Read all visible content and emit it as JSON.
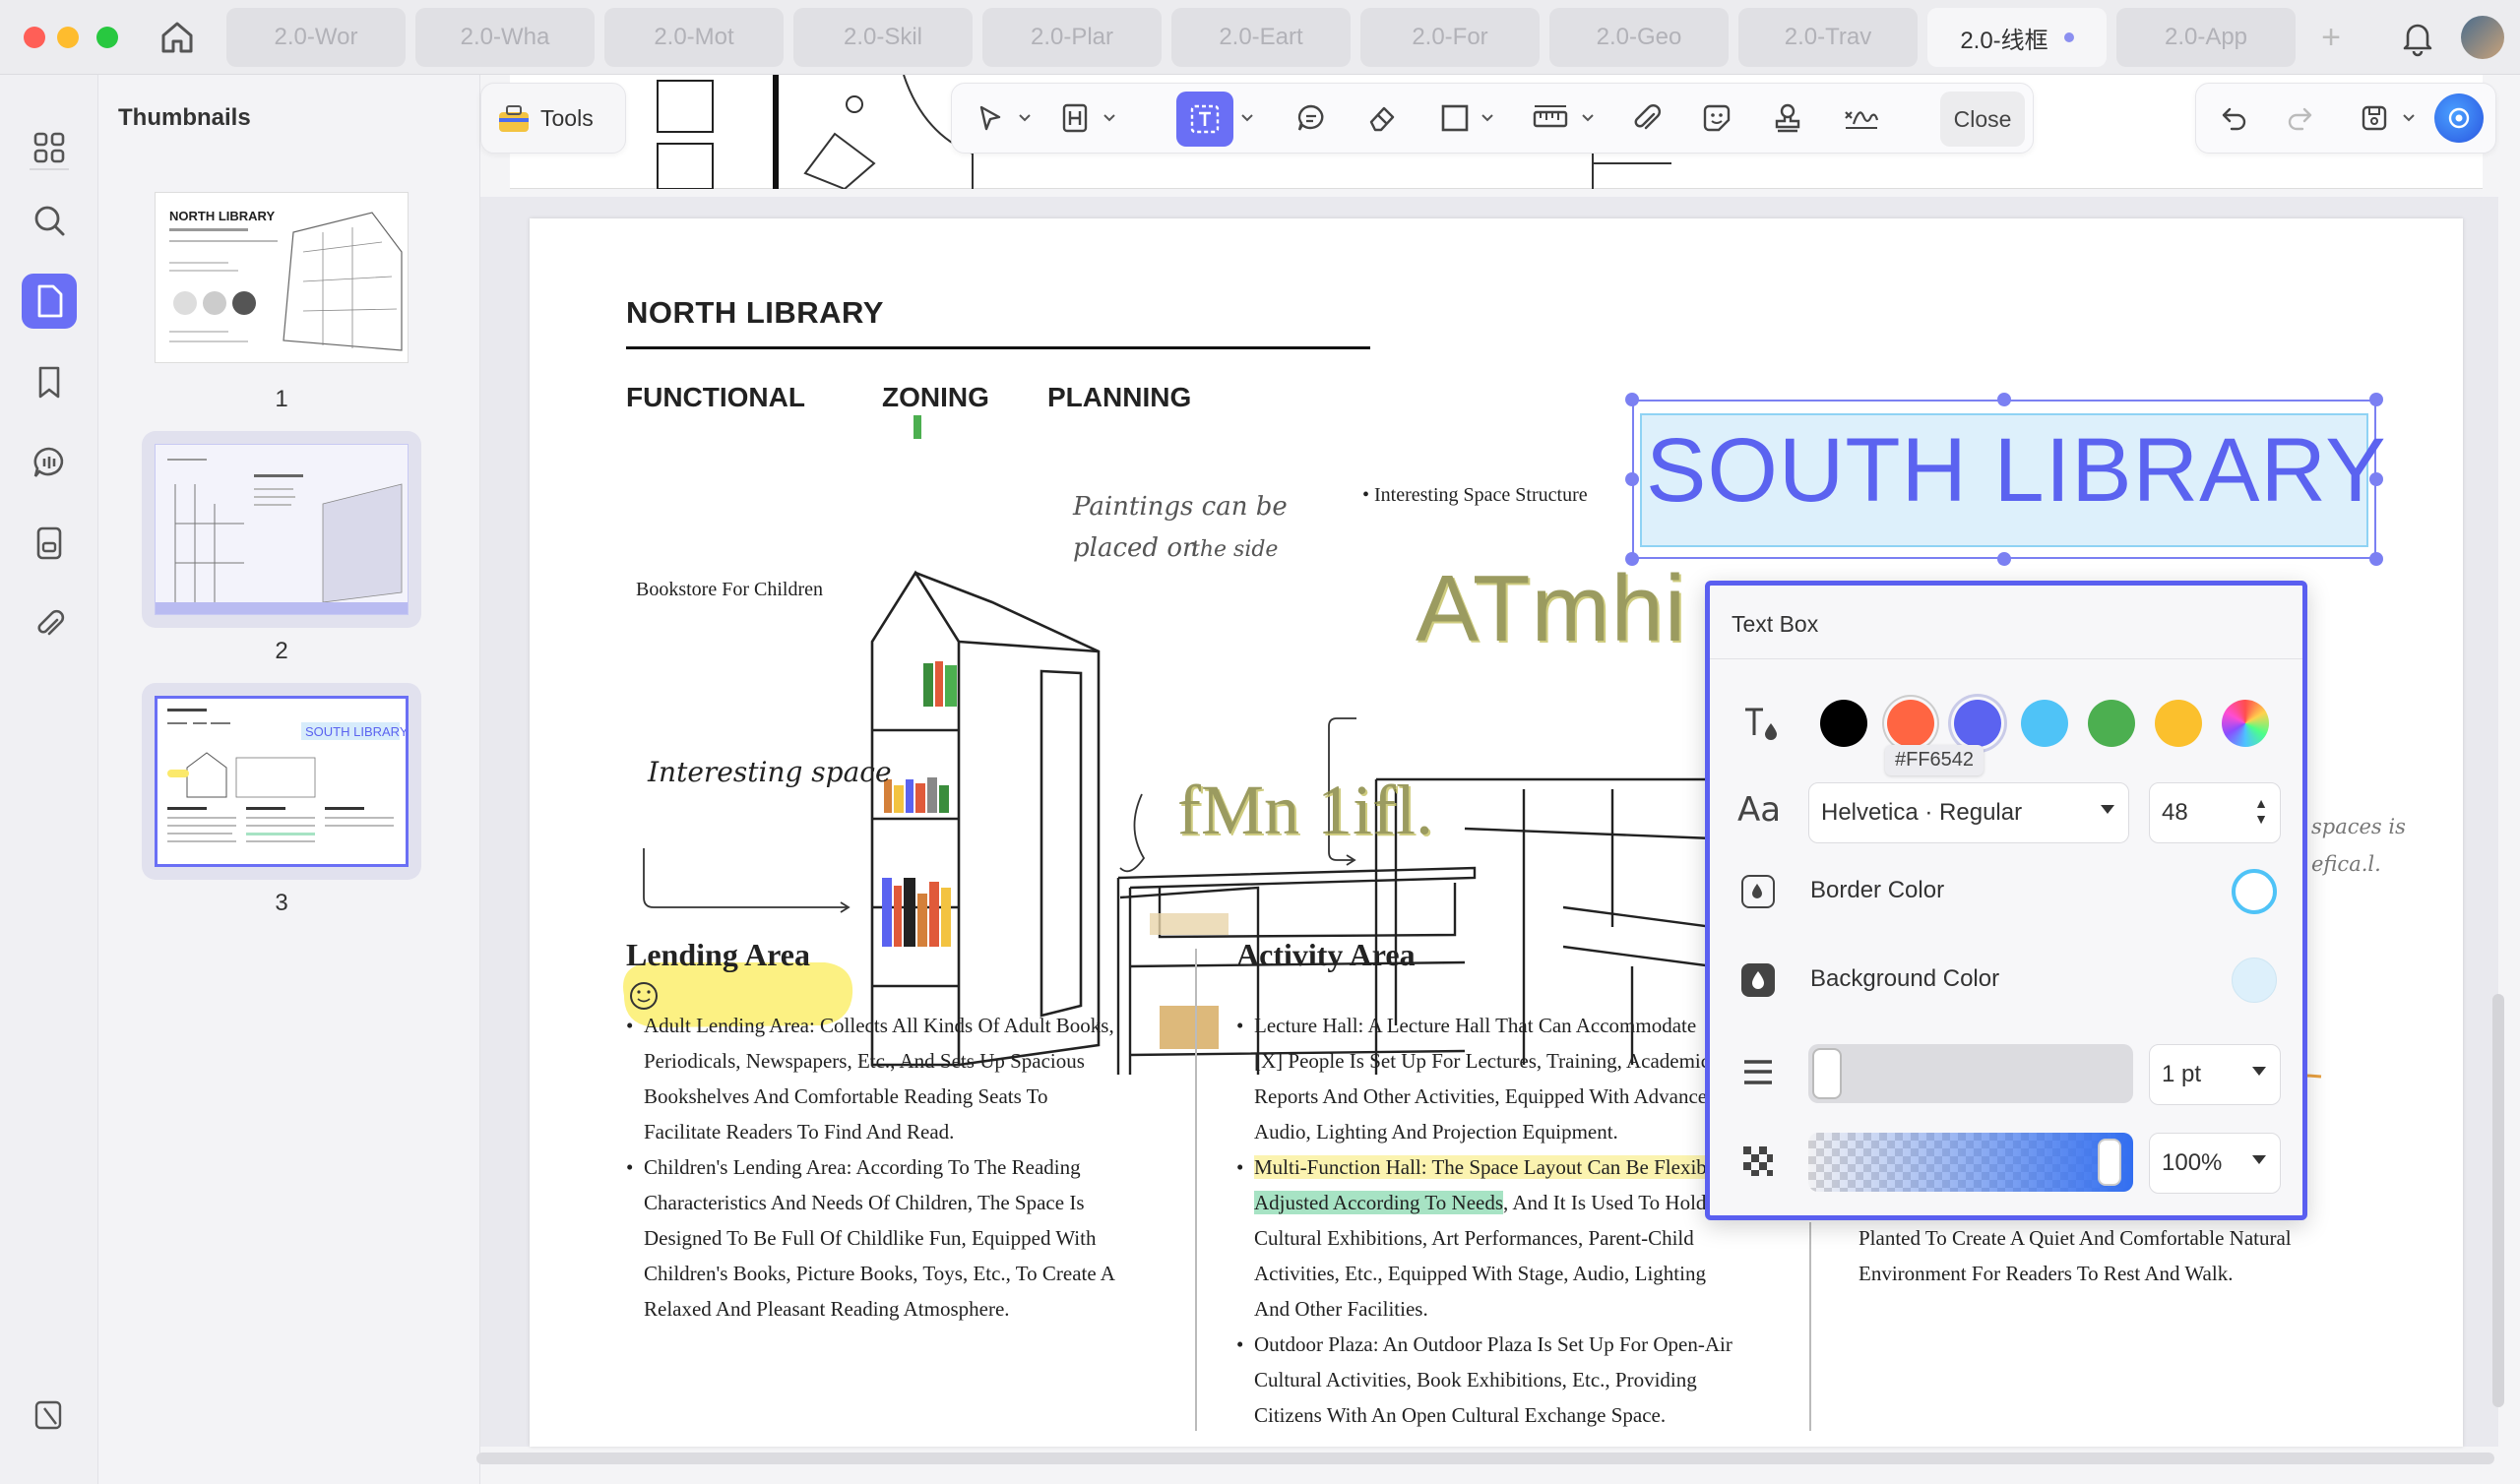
{
  "tabs": [
    {
      "label": "2.0-Wor"
    },
    {
      "label": "2.0-Wha"
    },
    {
      "label": "2.0-Mot"
    },
    {
      "label": "2.0-Skil"
    },
    {
      "label": "2.0-Plar"
    },
    {
      "label": "2.0-Eart"
    },
    {
      "label": "2.0-For"
    },
    {
      "label": "2.0-Geo"
    },
    {
      "label": "2.0-Trav"
    },
    {
      "label": "2.0-线框"
    },
    {
      "label": "2.0-App"
    }
  ],
  "sidebar": {
    "title": "Thumbnails",
    "pages": [
      "1",
      "2",
      "3"
    ]
  },
  "toolbar": {
    "tools_label": "Tools",
    "close_label": "Close"
  },
  "document": {
    "title": "NORTH LIBRARY",
    "subheads": [
      "FUNCTIONAL",
      "ZONING",
      "PLANNING"
    ],
    "selected_text": "SOUTH LIBRARY",
    "annotations": {
      "paintings": "Paintings can be",
      "paintings2": "placed on",
      "paintings3": "the side",
      "structure": "Interesting Space Structure",
      "bookstore": "Bookstore For Children",
      "interesting": "Interesting space",
      "overlay1": "ATmhi",
      "overlay2": "fMn 1ifl.",
      "spaces": "spaces is",
      "efical": "efica.l."
    },
    "lending": {
      "heading": "Lending Area",
      "items": [
        [
          "Adult Lending Area: Collects All Kinds Of Adult Books,",
          "Periodicals, Newspapers, Etc., And Sets Up Spacious",
          "Bookshelves And Comfortable Reading Seats To",
          "Facilitate Readers To Find And Read."
        ],
        [
          "Children's Lending Area: According To The Reading",
          "Characteristics And Needs Of Children, The Space Is",
          "Designed To Be Full Of Childlike Fun, Equipped With",
          "Children's Books, Picture Books, Toys, Etc., To Create A",
          "Relaxed And Pleasant Reading Atmosphere."
        ]
      ]
    },
    "activity": {
      "heading": "Activity Area",
      "item1": [
        "Lecture Hall: A Lecture Hall That Can Accommodate",
        "[X] People Is Set Up For Lectures, Training, Academic",
        "Reports And Other Activities, Equipped With Advance",
        "Audio, Lighting And Projection Equipment."
      ],
      "item2_hl1": "Multi-Function Hall: The Space Layout Can Be Flexib",
      "item2_hl2": "Adjusted According To Needs",
      "item2_rest": ", And It Is Used To Hold",
      "item2_more": [
        "Cultural Exhibitions, Art Performances, Parent-Child",
        "Activities, Etc., Equipped With Stage, Audio, Lighting",
        "And Other Facilities."
      ],
      "item3": [
        "Outdoor Plaza: An Outdoor Plaza Is Set Up For Open-Air",
        "Cultural Activities, Book Exhibitions, Etc., Providing",
        "Citizens With An Open Cultural Exchange Space."
      ]
    },
    "third_col": [
      "Planted To Create A Quiet And Comfortable Natural",
      "Environment For Readers To Rest And Walk."
    ]
  },
  "textbox_panel": {
    "title": "Text Box",
    "colors": [
      "#000000",
      "#FF6542",
      "#5B63F0",
      "#4FC3F7",
      "#4CAF50",
      "#FBC02D",
      "rainbow"
    ],
    "tooltip": "#FF6542",
    "font": "Helvetica · Regular",
    "size": "48",
    "border_label": "Border Color",
    "background_label": "Background Color",
    "border_color": "#4FC3F7",
    "background_color": "#DDF0FB",
    "line_width": "1 pt",
    "opacity": "100%"
  }
}
